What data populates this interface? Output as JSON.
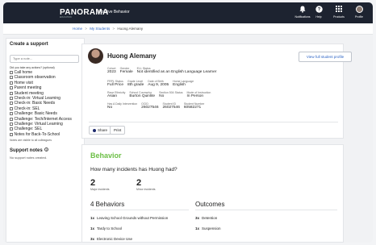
{
  "header": {
    "brand": "PANORAMA",
    "brand_sub": "EDUCATION",
    "app_title": "Positive Behavior",
    "nav": [
      {
        "label": "Notifications",
        "icon": "bell-icon"
      },
      {
        "label": "Help",
        "icon": "help-icon"
      },
      {
        "label": "Products",
        "icon": "grid-icon"
      },
      {
        "label": "Profile",
        "icon": "avatar-icon"
      }
    ]
  },
  "breadcrumb": {
    "home": "Home",
    "sep": ">",
    "my_students": "My Students",
    "current": "Huong Alemany"
  },
  "sidebar": {
    "title": "Create a support",
    "search_placeholder": "Type a note...",
    "question": "Did you take any actions? (optional)",
    "options": [
      "Call home",
      "Classroom observation",
      "Home visit",
      "Parent meeting",
      "Student meeting",
      "Check-in: Virtual Learning",
      "Check-in: Basic Needs",
      "Check-in: SEL",
      "Challenge: Basic Needs",
      "Challenge: Tech/Internet Access",
      "Challenge: Virtual Learning",
      "Challenge: SEL",
      "Notes for Back-To-School"
    ],
    "visibility_note": "Notes are visible to all colleagues",
    "support_notes_title": "Support notes",
    "support_notes_empty": "No support notes created."
  },
  "profile": {
    "name": "Huong Alemany",
    "view_profile_label": "View full student profile",
    "rows": [
      [
        {
          "k": "Cohort",
          "v": "2023"
        },
        {
          "k": "Gender",
          "v": "Female"
        },
        {
          "k": "ELL Status",
          "v": "Not identified as an English Language Learner"
        }
      ],
      [
        {
          "k": "FRPL Status",
          "v": "Full Price"
        },
        {
          "k": "Grade Level",
          "v": "8th grade"
        },
        {
          "k": "Date of Birth",
          "v": "Aug 9, 2005"
        },
        {
          "k": "Home Language",
          "v": "English"
        }
      ],
      [
        {
          "k": "Race Ethnicity",
          "v": "Asian"
        },
        {
          "k": "School Counselor",
          "v": "Burton Quinlite"
        },
        {
          "k": "Section 504 Status",
          "v": "No"
        },
        {
          "k": "Mode of Instruction",
          "v": "In Person"
        }
      ],
      [
        {
          "k": "Has A Daily Intervention",
          "v": "No"
        },
        {
          "k": "OCID",
          "v": "26027546"
        },
        {
          "k": "Student ID",
          "v": "26027546"
        },
        {
          "k": "Student Number",
          "v": "60582271"
        }
      ]
    ],
    "share_label": "Share",
    "print_label": "Print"
  },
  "behavior": {
    "title": "Behavior",
    "question": "How many incidents has Huong had?",
    "major_count": "2",
    "major_label": "Major incidents",
    "minor_count": "2",
    "minor_label": "Minor incidents",
    "behaviors_header": "4 Behaviors",
    "outcomes_header": "Outcomes",
    "behaviors": [
      {
        "count": "1x",
        "label": "Leaving School Grounds without Permission"
      },
      {
        "count": "1x",
        "label": "Tardy to School"
      },
      {
        "count": "3x",
        "label": "Electronic Device Use"
      }
    ],
    "outcomes": [
      {
        "count": "3x",
        "label": "Detention"
      },
      {
        "count": "1x",
        "label": "Suspension"
      }
    ]
  }
}
